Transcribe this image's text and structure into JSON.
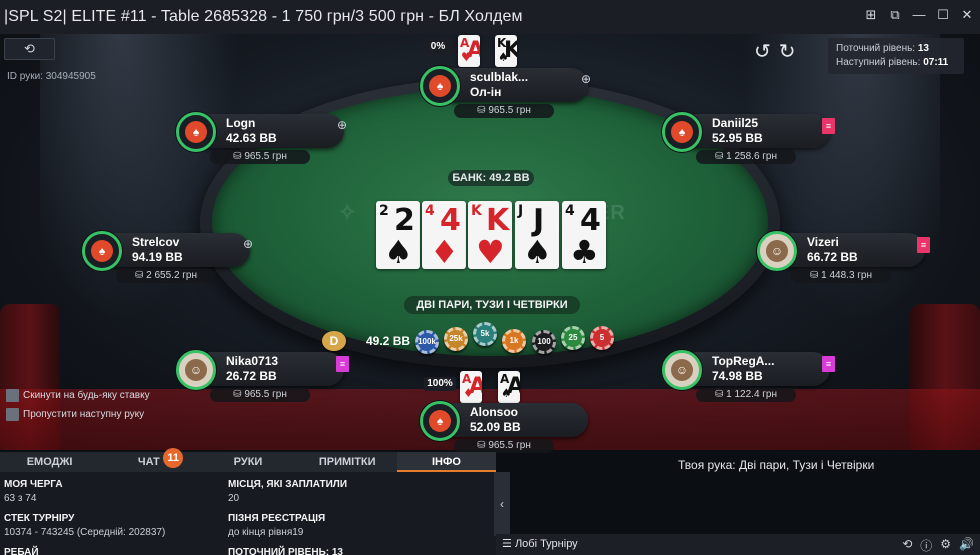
{
  "window": {
    "title": "|SPL S2| ELITE  #11 - Table 2685328 - 1 750 грн/3 500 грн - БЛ Холдем",
    "controls": [
      "grid-icon",
      "tile-icon",
      "minimize-icon",
      "maximize-icon",
      "close-icon"
    ]
  },
  "hand_id": "ID руки: 304945905",
  "level": {
    "current_label": "Поточний рівень:",
    "current_value": "13",
    "next_label": "Наступний рівень:",
    "next_value": "07:11"
  },
  "pot": {
    "bank_label": "БАНК: 49.2 BB",
    "amount": "49.2 BB",
    "result": "ДВІ ПАРИ, ТУЗИ І ЧЕТВІРКИ",
    "chips": [
      "100k",
      "25k",
      "5k",
      "1k",
      "100",
      "25",
      "5"
    ]
  },
  "dealer_label": "D",
  "board": [
    {
      "rank": "2",
      "suit": "♠",
      "color": "black"
    },
    {
      "rank": "4",
      "suit": "♦",
      "color": "red"
    },
    {
      "rank": "K",
      "suit": "♥",
      "color": "red"
    },
    {
      "rank": "J",
      "suit": "♠",
      "color": "black"
    },
    {
      "rank": "4",
      "suit": "♣",
      "color": "black"
    }
  ],
  "seats": {
    "top": {
      "name": "sculblak...",
      "stack": "Ол-ін",
      "bank": "965.5 грн",
      "equity": "0%",
      "cards": [
        {
          "rank": "A",
          "suit": "♥",
          "color": "red"
        },
        {
          "rank": "K",
          "suit": "♠",
          "color": "black"
        }
      ]
    },
    "topleft": {
      "name": "Logn",
      "stack": "42.63 BB",
      "bank": "965.5 грн"
    },
    "topright": {
      "name": "Daniil25",
      "stack": "52.95 BB",
      "bank": "1 258.6 грн"
    },
    "left": {
      "name": "Strelcov",
      "stack": "94.19 BB",
      "bank": "2 655.2 грн"
    },
    "right": {
      "name": "Vizeri",
      "stack": "66.72 BB",
      "bank": "1 448.3 грн"
    },
    "bottomleft": {
      "name": "Nika0713",
      "stack": "26.72 BB",
      "bank": "965.5 грн"
    },
    "bottomright": {
      "name": "TopRegA...",
      "stack": "74.98 BB",
      "bank": "1 122.4 грн"
    },
    "hero": {
      "name": "Alonsoo",
      "stack": "52.09 BB",
      "bank": "965.5 грн",
      "equity": "100%",
      "cards": [
        {
          "rank": "A",
          "suit": "♦",
          "color": "red"
        },
        {
          "rank": "A",
          "suit": "♠",
          "color": "black"
        }
      ]
    }
  },
  "options": {
    "fold_any": "Скинути на будь-яку ставку",
    "skip_hand": "Пропустити наступну руку"
  },
  "your_hand": "Твоя рука: Дві пари, Тузи і Четвірки",
  "tabs": [
    {
      "label": "ЕМОДЖІ"
    },
    {
      "label": "ЧАТ",
      "badge": "11"
    },
    {
      "label": "РУКИ"
    },
    {
      "label": "ПРИМІТКИ"
    },
    {
      "label": "ІНФО"
    }
  ],
  "info": {
    "queue_label": "МОЯ ЧЕРГА",
    "queue_value": "63 з 74",
    "paid_label": "МІСЦЯ, ЯКІ ЗАПЛАТИЛИ",
    "paid_value": "20",
    "stack_label": "СТЕК ТУРНІРУ",
    "stack_value": "10374 - 743245 (Середній: 202837)",
    "late_label": "ПІЗНЯ РЕЄСТРАЦІЯ",
    "late_value": "до кінця рівня19",
    "cut1": "РЕБАЙ",
    "cut2": "ПОТОЧНИЙ РІВЕНЬ: 13"
  },
  "lobby": "Лобі Турніру"
}
